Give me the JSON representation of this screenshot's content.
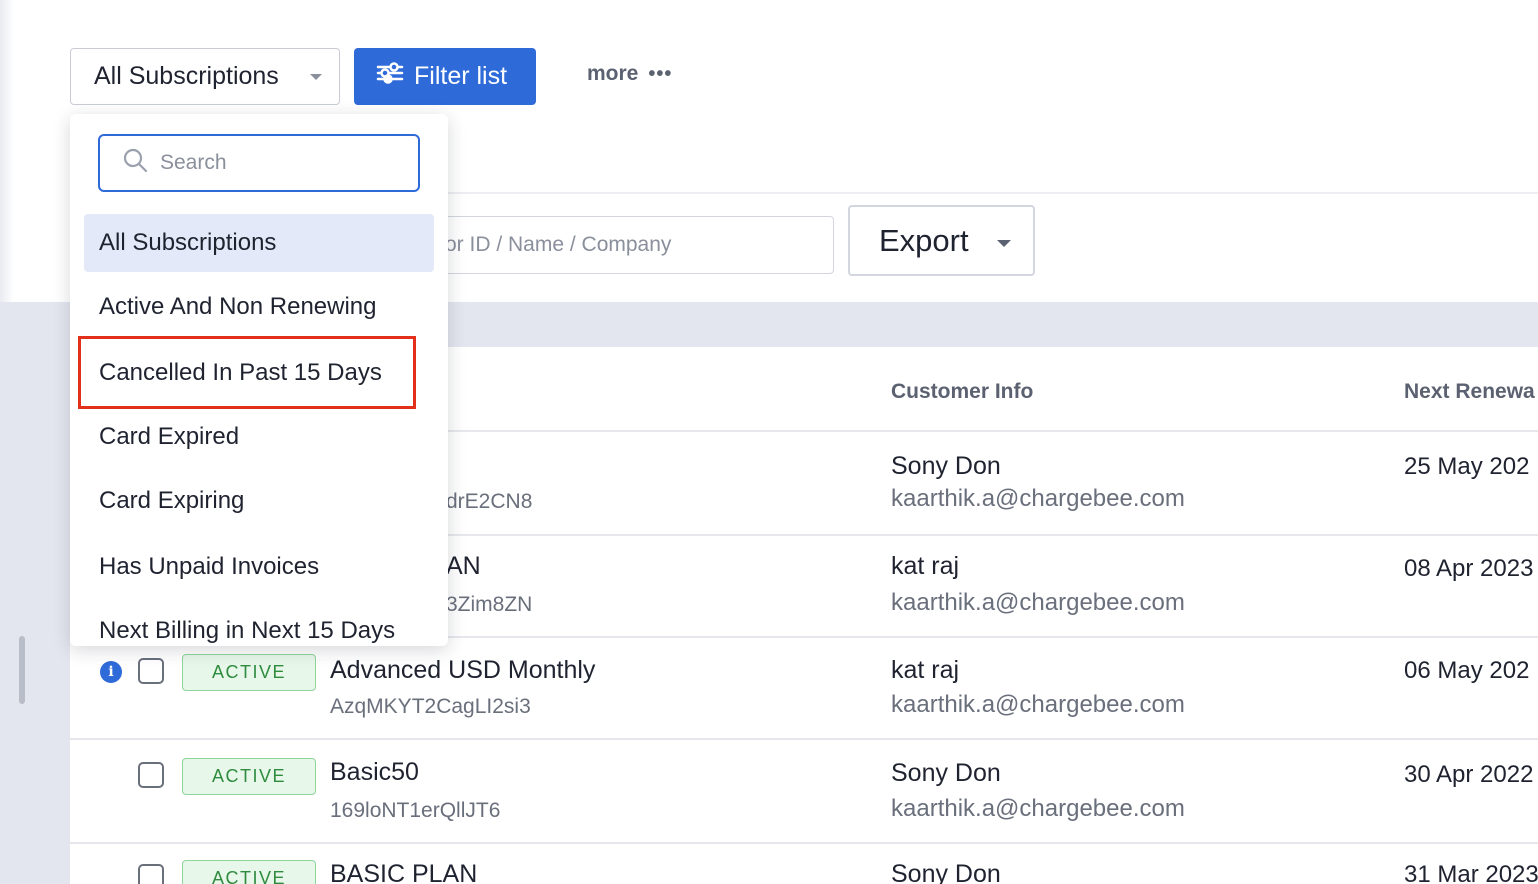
{
  "toolbar": {
    "subscriptions_select_value": "All Subscriptions",
    "filter_button_label": "Filter list",
    "more_label": "more",
    "more_dots": "•••"
  },
  "search_bar": {
    "placeholder_visible": "or ID / Name / Company"
  },
  "export": {
    "label": "Export"
  },
  "table": {
    "headers": {
      "customer_info": "Customer Info",
      "next_renewal": "Next Renewa"
    },
    "rows": [
      {
        "status": "",
        "plan_name": "",
        "plan_id": "drE2CN8",
        "customer_name": "Sony Don",
        "customer_email": "kaarthik.a@chargebee.com",
        "next_renewal": "25 May 202"
      },
      {
        "status": "",
        "plan_name": "AN",
        "plan_id": "3Zim8ZN",
        "customer_name": "kat raj",
        "customer_email": "kaarthik.a@chargebee.com",
        "next_renewal": "08 Apr 2023"
      },
      {
        "status": "ACTIVE",
        "plan_name": "Advanced USD Monthly",
        "plan_id": "AzqMKYT2CagLI2si3",
        "customer_name": "kat raj",
        "customer_email": "kaarthik.a@chargebee.com",
        "next_renewal": "06 May 202",
        "info_icon": "i"
      },
      {
        "status": "ACTIVE",
        "plan_name": "Basic50",
        "plan_id": "169loNT1erQllJT6",
        "customer_name": "Sony Don",
        "customer_email": "kaarthik.a@chargebee.com",
        "next_renewal": "30 Apr 2022"
      },
      {
        "status": "ACTIVE",
        "plan_name": "BASIC PLAN",
        "plan_id": "",
        "customer_name": "Sony Don",
        "customer_email": "",
        "next_renewal": "31 Mar 2023"
      }
    ]
  },
  "dropdown": {
    "search_placeholder": "Search",
    "items": [
      "All Subscriptions",
      "Active And Non Renewing",
      "Cancelled In Past 15 Days",
      "Card Expired",
      "Card Expiring",
      "Has Unpaid Invoices",
      "Next Billing in Next 15 Days"
    ],
    "selected_item": "All Subscriptions",
    "highlighted_item": "Cancelled In Past 15 Days"
  },
  "colors": {
    "primary": "#2f6ad9",
    "active_badge_text": "#2f8c3f",
    "active_badge_bg": "#e7f7ea",
    "highlight_border": "#e2301a",
    "selected_item_bg": "#e3e9f8"
  },
  "icons": {
    "filter_button": "sliders-icon",
    "more": "ellipsis-icon",
    "dropdown_search": "search-icon",
    "select_caret": "caret-down-icon",
    "info": "info-icon"
  }
}
